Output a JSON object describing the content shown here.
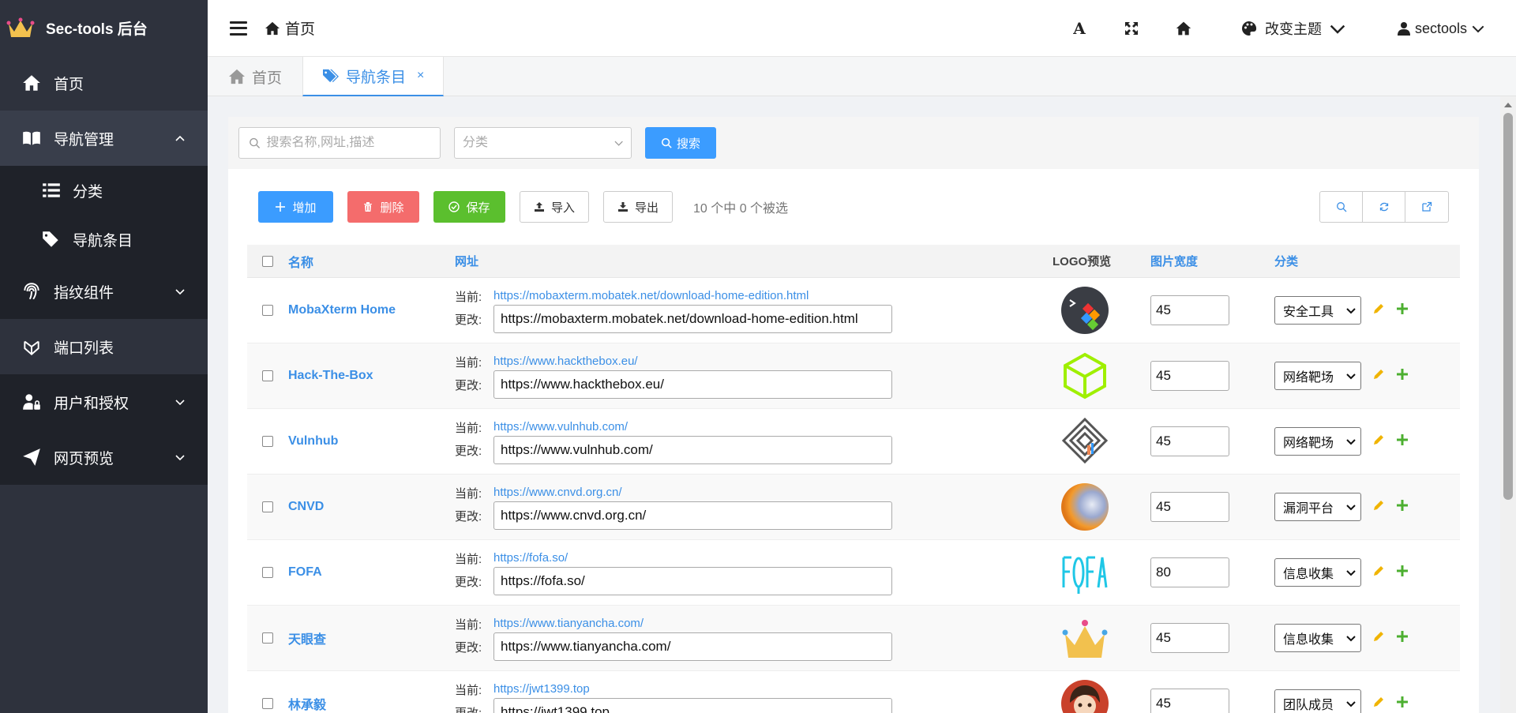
{
  "brand": {
    "name": "Sec-tools 后台"
  },
  "sidebar": {
    "items": [
      {
        "label": "首页"
      },
      {
        "label": "导航管理",
        "children": [
          {
            "label": "分类"
          },
          {
            "label": "导航条目"
          }
        ]
      },
      {
        "label": "指纹组件"
      },
      {
        "label": "端口列表"
      },
      {
        "label": "用户和授权"
      },
      {
        "label": "网页预览"
      }
    ]
  },
  "header": {
    "home": "首页",
    "theme": "改变主题",
    "user": "sectools",
    "font_btn": "A"
  },
  "tabs": [
    {
      "label": "首页"
    },
    {
      "label": "导航条目",
      "close": "×"
    }
  ],
  "filter": {
    "search_placeholder": "搜索名称,网址,描述",
    "category_placeholder": "分类",
    "search_btn": "搜索"
  },
  "toolbar": {
    "add": "增加",
    "delete": "删除",
    "save": "保存",
    "import": "导入",
    "export": "导出",
    "selection": "10 个中 0 个被选"
  },
  "table": {
    "headers": {
      "name": "名称",
      "url": "网址",
      "logo": "LOGO预览",
      "width": "图片宽度",
      "category": "分类"
    },
    "current_label": "当前:",
    "change_label": "更改:",
    "rows": [
      {
        "name": "MobaXterm Home",
        "url": "https://mobaxterm.mobatek.net/download-home-edition.html",
        "width": "45",
        "category": "安全工具",
        "logo": "mobaxterm-logo"
      },
      {
        "name": "Hack-The-Box",
        "url": "https://www.hackthebox.eu/",
        "width": "45",
        "category": "网络靶场",
        "logo": "hackthebox-logo"
      },
      {
        "name": "Vulnhub",
        "url": "https://www.vulnhub.com/",
        "width": "45",
        "category": "网络靶场",
        "logo": "vulnhub-logo"
      },
      {
        "name": "CNVD",
        "url": "https://www.cnvd.org.cn/",
        "width": "45",
        "category": "漏洞平台",
        "logo": "cnvd-logo"
      },
      {
        "name": "FOFA",
        "url": "https://fofa.so/",
        "width": "80",
        "category": "信息收集",
        "logo": "fofa-logo"
      },
      {
        "name": "天眼查",
        "url": "https://www.tianyancha.com/",
        "width": "45",
        "category": "信息收集",
        "logo": "tianyancha-logo"
      },
      {
        "name": "林承毅",
        "url": "https://jwt1399.top",
        "width": "45",
        "category": "团队成员",
        "logo": "avatar-logo"
      }
    ]
  },
  "colors": {
    "sidebar": "#2e323d",
    "accent": "#3b8fe6",
    "danger": "#f46c6c",
    "success": "#5bbf2e"
  }
}
